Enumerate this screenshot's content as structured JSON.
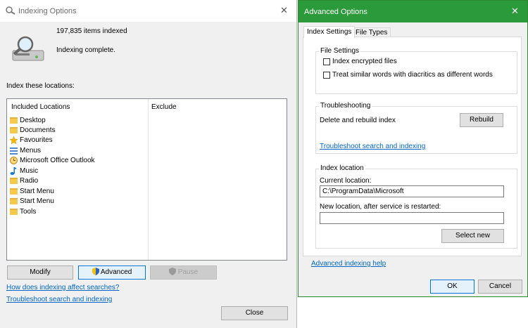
{
  "indexing_window": {
    "title": "Indexing Options",
    "items_indexed": "197,835 items indexed",
    "status": "Indexing complete.",
    "index_label": "Index these locations:",
    "columns": {
      "included": "Included Locations",
      "exclude": "Exclude"
    },
    "locations": [
      {
        "label": "Desktop",
        "icon": "folder-icon"
      },
      {
        "label": "Documents",
        "icon": "folder-icon"
      },
      {
        "label": "Favourites",
        "icon": "star-icon"
      },
      {
        "label": "Menus",
        "icon": "menu-icon"
      },
      {
        "label": "Microsoft Office Outlook",
        "icon": "outlook-icon"
      },
      {
        "label": "Music",
        "icon": "music-icon"
      },
      {
        "label": "Radio",
        "icon": "folder-icon"
      },
      {
        "label": "Start Menu",
        "icon": "folder-icon"
      },
      {
        "label": "Start Menu",
        "icon": "folder-icon"
      },
      {
        "label": "Tools",
        "icon": "folder-icon"
      }
    ],
    "buttons": {
      "modify": "Modify",
      "advanced": "Advanced",
      "pause": "Pause",
      "close": "Close"
    },
    "links": {
      "how_affect": "How does indexing affect searches?",
      "troubleshoot": "Troubleshoot search and indexing"
    },
    "close_glyph": "✕"
  },
  "advanced_window": {
    "title": "Advanced Options",
    "close_glyph": "✕",
    "tabs": [
      "Index Settings",
      "File Types"
    ],
    "file_settings": {
      "label": "File Settings",
      "encrypt": "Index encrypted files",
      "diacritics": "Treat similar words with diacritics as different words"
    },
    "troubleshooting": {
      "label": "Troubleshooting",
      "rebuild_text": "Delete and rebuild index",
      "rebuild_button": "Rebuild",
      "link": "Troubleshoot search and indexing"
    },
    "index_location": {
      "label": "Index location",
      "current_label": "Current location:",
      "current_value": "C:\\ProgramData\\Microsoft",
      "new_label": "New location, after service is restarted:",
      "new_value": "",
      "select_button": "Select new"
    },
    "help_link": "Advanced indexing help",
    "ok": "OK",
    "cancel": "Cancel"
  }
}
